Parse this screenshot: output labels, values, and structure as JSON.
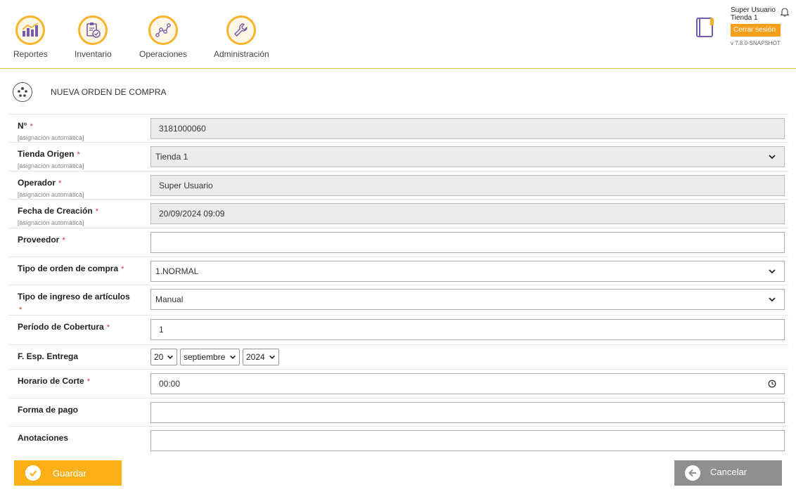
{
  "nav": {
    "reports": "Reportes",
    "inventory": "Inventario",
    "operations": "Operaciones",
    "administration": "Administración"
  },
  "user": {
    "name": "Super Usuario",
    "store": "Tienda 1",
    "logout_label": "Cerrar sesión",
    "version": "v 7.8.0-SNAPSHOT"
  },
  "page": {
    "title": "NUEVA ORDEN DE COMPRA"
  },
  "form": {
    "number": {
      "label": "N°",
      "sub": "[asignación automática]",
      "value": "3181000060"
    },
    "origin_store": {
      "label": "Tienda Origen",
      "sub": "[asignación automática]",
      "value": "Tienda 1"
    },
    "operator": {
      "label": "Operador",
      "sub": "[asignación automática]",
      "value": "Super Usuario"
    },
    "creation_date": {
      "label": "Fecha de Creación",
      "sub": "[asignación automática]",
      "value": "20/09/2024 09:09"
    },
    "supplier": {
      "label": "Proveedor",
      "value": ""
    },
    "order_type": {
      "label": "Tipo de orden de compra",
      "value": "1.NORMAL"
    },
    "entry_type": {
      "label": "Tipo de ingreso de artículos",
      "value": "Manual"
    },
    "coverage_period": {
      "label": "Período de Cobertura",
      "value": "1"
    },
    "expected_delivery": {
      "label": "F. Esp. Entrega",
      "day": "20",
      "month": "septiembre",
      "year": "2024"
    },
    "cutoff_time": {
      "label": "Horario de Corte",
      "value": "00:00"
    },
    "payment_method": {
      "label": "Forma de pago",
      "value": ""
    },
    "notes": {
      "label": "Anotaciones",
      "value": ""
    },
    "required_mark": "*"
  },
  "actions": {
    "save_label": "Guardar",
    "cancel_label": "Cancelar"
  },
  "colors": {
    "accent": "#fbb017",
    "accent_dark": "#f79e1b",
    "required": "#d32f2f",
    "cancel": "#8f8f8f"
  }
}
